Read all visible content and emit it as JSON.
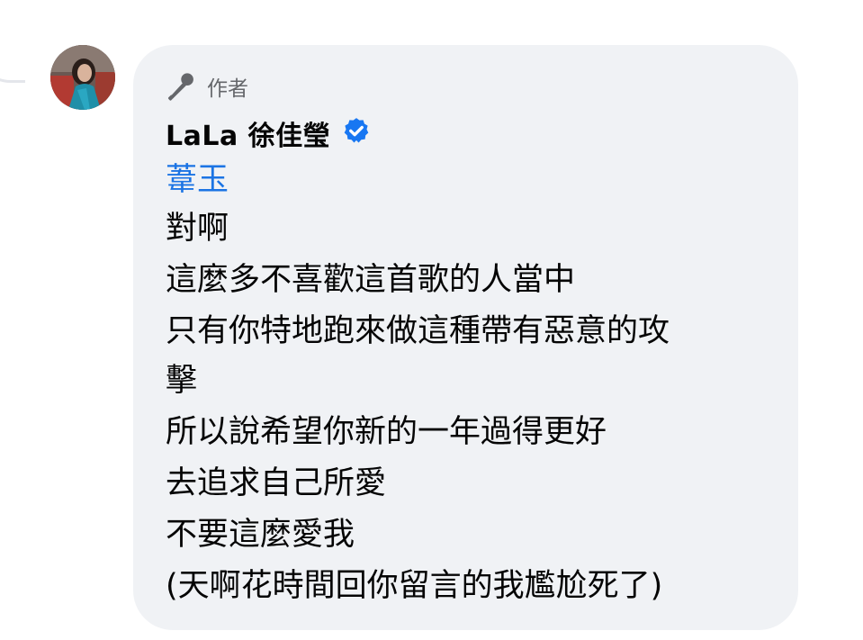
{
  "comment": {
    "badge_label": "作者",
    "badge_icon": "microphone-icon",
    "author_name": "LaLa 徐佳瑩",
    "verified_icon": "verified-badge-icon",
    "mention": "葦玉",
    "lines": [
      "對啊",
      "這麼多不喜歡這首歌的人當中",
      "只有你特地跑來做這種帶有惡意的攻",
      "擊",
      "所以說希望你新的一年過得更好",
      "去追求自己所愛",
      "不要這麼愛我",
      "(天啊花時間回你留言的我尷尬死了)"
    ]
  },
  "colors": {
    "bubble_background": "#f0f2f5",
    "mention_blue": "#1b74e4",
    "verified_blue": "#1877f2",
    "muted_text": "#65676b",
    "primary_text": "#050505"
  }
}
